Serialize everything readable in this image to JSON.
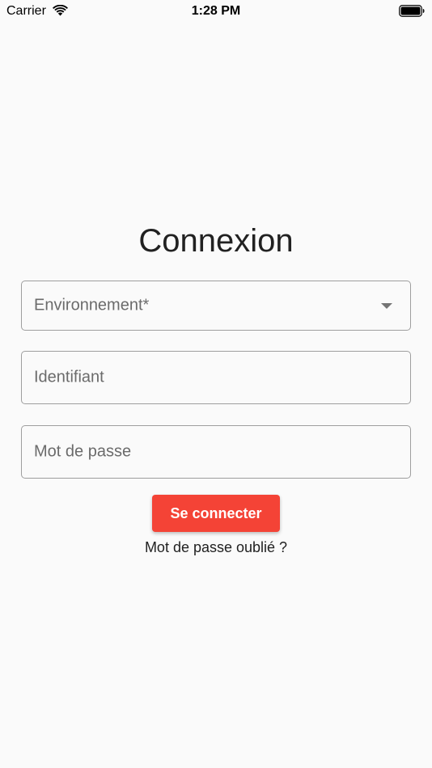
{
  "status_bar": {
    "carrier": "Carrier",
    "time": "1:28 PM",
    "wifi_icon": "wifi-icon",
    "battery_icon": "battery-icon"
  },
  "login": {
    "title": "Connexion",
    "environment_label": "Environnement*",
    "environment_icon": "dropdown-arrow-icon",
    "username_label": "Identifiant",
    "password_label": "Mot de passe",
    "submit_label": "Se connecter",
    "forgot_password_label": "Mot de passe oublié ?"
  },
  "colors": {
    "background": "#fafafa",
    "accent": "#f44336",
    "border": "#9e9e9e",
    "label": "#6b6b6b"
  }
}
